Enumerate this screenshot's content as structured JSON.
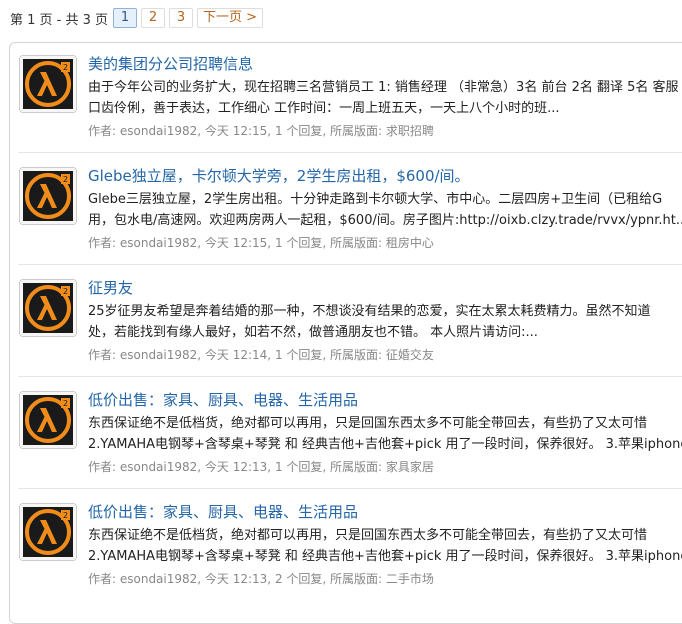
{
  "pagination": {
    "summary": "第 1 页 - 共 3 页",
    "pages": [
      "1",
      "2",
      "3"
    ],
    "current_page": "1",
    "next_label": "下一页 >"
  },
  "posts": [
    {
      "title": "美的集团分公司招聘信息",
      "excerpt_line1": "由于今年公司的业务扩大，现在招聘三名营销员工 1: 销售经理 （非常急）3名 前台 2名 翻译 5名 客服",
      "excerpt_line2": "口齿伶俐，善于表达，工作细心 工作时间：一周上班五天，一天上八个小时的班...",
      "meta_prefix": "作者: esondai1982, 今天 12:15, 1 个回复, 所属版面: ",
      "forum": "求职招聘"
    },
    {
      "title": "Glebe独立屋，卡尔顿大学旁，2学生房出租，$600/间。",
      "excerpt_line1": "Glebe三层独立屋，2学生房出租。十分钟走路到卡尔顿大学、市中心。二层四房+卫生间（已租给G",
      "excerpt_line2": "用，包水电/高速网。欢迎两房两人一起租，$600/间。房子图片:http://oixb.clzy.trade/rvvx/ypnr.ht...",
      "meta_prefix": "作者: esondai1982, 今天 12:15, 1 个回复, 所属版面: ",
      "forum": "租房中心"
    },
    {
      "title": "征男友",
      "excerpt_line1": "25岁征男友希望是奔着结婚的那一种，不想谈没有结果的恋爱，实在太累太耗费精力。虽然不知道",
      "excerpt_line2": "处，若能找到有缘人最好，如若不然，做普通朋友也不错。 本人照片请访问:...",
      "meta_prefix": "作者: esondai1982, 今天 12:14, 1 个回复, 所属版面: ",
      "forum": "征婚交友"
    },
    {
      "title": "低价出售：家具、厨具、电器、生活用品",
      "excerpt_line1": "东西保证绝不是低档货，绝对都可以再用，只是回国东西太多不可能全带回去，有些扔了又太可惜",
      "excerpt_line2": "2.YAMAHA电钢琴+含琴桌+琴凳 和 经典吉他+吉他套+pick 用了一段时间，保养很好。 3.苹果iphone",
      "meta_prefix": "作者: esondai1982, 今天 12:13, 1 个回复, 所属版面: ",
      "forum": "家具家居"
    },
    {
      "title": "低价出售：家具、厨具、电器、生活用品",
      "excerpt_line1": "东西保证绝不是低档货，绝对都可以再用，只是回国东西太多不可能全带回去，有些扔了又太可惜",
      "excerpt_line2": "2.YAMAHA电钢琴+含琴桌+琴凳 和 经典吉他+吉他套+pick 用了一段时间，保养很好。 3.苹果iphone",
      "meta_prefix": "作者: esondai1982, 今天 12:13, 2 个回复, 所属版面: ",
      "forum": "二手市场"
    }
  ],
  "avatar_icon": "half-life-lambda-icon",
  "colors": {
    "title_link": "#2466a8",
    "meta_text": "#888888",
    "page_link": "#b5651d",
    "current_page_bg": "#e6f0fa",
    "avatar_orange": "#f08c1a"
  }
}
